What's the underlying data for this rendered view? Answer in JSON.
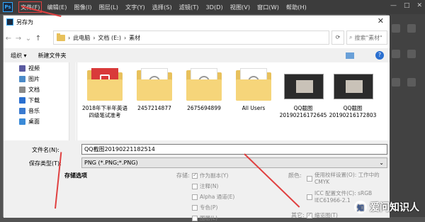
{
  "app": {
    "logo": "Ps",
    "menus": [
      "文件(F)",
      "编辑(E)",
      "图像(I)",
      "图层(L)",
      "文字(Y)",
      "选择(S)",
      "滤镜(T)",
      "3D(D)",
      "视图(V)",
      "窗口(W)",
      "帮助(H)"
    ],
    "window_controls": [
      "—",
      "□",
      "✕"
    ]
  },
  "dialog": {
    "title": "另存为",
    "close": "✕",
    "nav": {
      "back": "←",
      "forward": "→",
      "recent": "⌄",
      "up": "↑"
    },
    "path": [
      "此电脑",
      "文档 (E:)",
      "素材"
    ],
    "path_sep": "›",
    "search_placeholder": "搜索\"素材\"",
    "toolbar": {
      "organize": "组织 ▾",
      "new_folder": "新建文件夹",
      "help": "?"
    },
    "sidebar": [
      {
        "label": "视频",
        "icon": "video-icon",
        "color": "#5a5aa0"
      },
      {
        "label": "图片",
        "icon": "pictures-icon",
        "color": "#4a8ac8"
      },
      {
        "label": "文档",
        "icon": "documents-icon",
        "color": "#8a8a8a"
      },
      {
        "label": "下载",
        "icon": "download-icon",
        "color": "#2a6fd0"
      },
      {
        "label": "音乐",
        "icon": "music-icon",
        "color": "#3a7ad0"
      },
      {
        "label": "桌面",
        "icon": "desktop-icon",
        "color": "#3a8ad8"
      }
    ],
    "files": [
      {
        "name": "2018年下半年英语四级笔试准考",
        "kind": "folder-pdf"
      },
      {
        "name": "2457214877",
        "kind": "folder"
      },
      {
        "name": "2675694899",
        "kind": "folder"
      },
      {
        "name": "All Users",
        "kind": "folder"
      },
      {
        "name": "QQ截图20190216172645",
        "kind": "photo"
      },
      {
        "name": "QQ截图20190216172803",
        "kind": "photo"
      }
    ],
    "filename_label": "文件名(N):",
    "filename_value": "QQ截图20190221182514",
    "filetype_label": "保存类型(T):",
    "filetype_value": "PNG (*.PNG;*.PNG)",
    "save_options_label": "存储选项",
    "storage": {
      "label": "存储:",
      "options": [
        {
          "label": "作为副本(Y)",
          "checked": true
        },
        {
          "label": "注释(N)",
          "checked": false
        },
        {
          "label": "Alpha 通道(E)",
          "checked": false
        },
        {
          "label": "专色(P)",
          "checked": false
        },
        {
          "label": "图层(L)",
          "checked": false
        }
      ]
    },
    "color": {
      "label": "颜色:",
      "options": [
        {
          "label": "使用校样设置(O): 工作中的 CMYK",
          "checked": false
        },
        {
          "label": "ICC 配置文件(C): sRGB IEC61966-2.1",
          "checked": false
        },
        {
          "label": "缩览图(T)",
          "checked": true
        }
      ]
    },
    "other_label": "其它:"
  },
  "watermark": {
    "icon": "知",
    "text": "爱问知识人"
  }
}
